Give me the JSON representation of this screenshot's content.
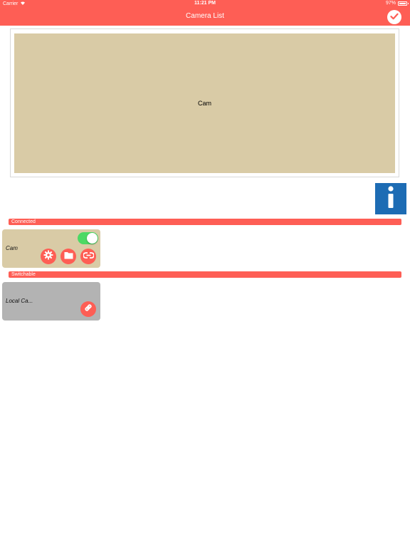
{
  "status_bar": {
    "carrier": "Carrier",
    "time": "11:21 PM",
    "battery": "97%"
  },
  "nav": {
    "title": "Camera List",
    "done_icon": "checkmark-icon"
  },
  "preview": {
    "label": "Cam"
  },
  "info_icon": "info-icon",
  "sections": {
    "connected": {
      "title": "Connected",
      "camera": {
        "name": "Cam",
        "enabled": true,
        "actions": [
          "settings-icon",
          "folder-icon",
          "unlink-icon"
        ]
      }
    },
    "switchable": {
      "title": "Switchable",
      "camera": {
        "name": "Local Ca...",
        "actions": [
          "link-icon"
        ]
      }
    }
  },
  "colors": {
    "accent": "#fe5e55",
    "preview_bg": "#d9cba6",
    "connected_card": "#d9cba6",
    "switchable_card": "#b3b3b3",
    "info_blue": "#1d6cb4",
    "toggle_on": "#4cd964"
  }
}
